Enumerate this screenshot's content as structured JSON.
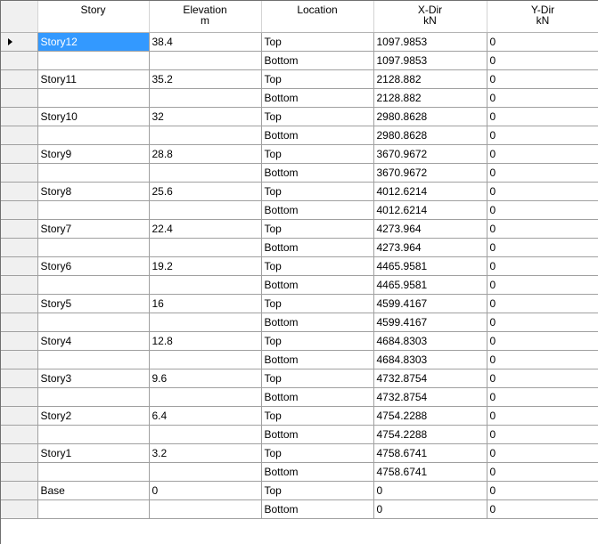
{
  "grid": {
    "columns": [
      {
        "title": "Story",
        "unit": ""
      },
      {
        "title": "Elevation",
        "unit": "m"
      },
      {
        "title": "Location",
        "unit": ""
      },
      {
        "title": "X-Dir",
        "unit": "kN"
      },
      {
        "title": "Y-Dir",
        "unit": "kN"
      }
    ],
    "current_row": 0,
    "selected_cell": {
      "row": 0,
      "col": 0
    },
    "rows": [
      {
        "story": "Story12",
        "elevation": "38.4",
        "location": "Top",
        "xdir": "1097.9853",
        "ydir": "0"
      },
      {
        "story": "",
        "elevation": "",
        "location": "Bottom",
        "xdir": "1097.9853",
        "ydir": "0"
      },
      {
        "story": "Story11",
        "elevation": "35.2",
        "location": "Top",
        "xdir": "2128.882",
        "ydir": "0"
      },
      {
        "story": "",
        "elevation": "",
        "location": "Bottom",
        "xdir": "2128.882",
        "ydir": "0"
      },
      {
        "story": "Story10",
        "elevation": "32",
        "location": "Top",
        "xdir": "2980.8628",
        "ydir": "0"
      },
      {
        "story": "",
        "elevation": "",
        "location": "Bottom",
        "xdir": "2980.8628",
        "ydir": "0"
      },
      {
        "story": "Story9",
        "elevation": "28.8",
        "location": "Top",
        "xdir": "3670.9672",
        "ydir": "0"
      },
      {
        "story": "",
        "elevation": "",
        "location": "Bottom",
        "xdir": "3670.9672",
        "ydir": "0"
      },
      {
        "story": "Story8",
        "elevation": "25.6",
        "location": "Top",
        "xdir": "4012.6214",
        "ydir": "0"
      },
      {
        "story": "",
        "elevation": "",
        "location": "Bottom",
        "xdir": "4012.6214",
        "ydir": "0"
      },
      {
        "story": "Story7",
        "elevation": "22.4",
        "location": "Top",
        "xdir": "4273.964",
        "ydir": "0"
      },
      {
        "story": "",
        "elevation": "",
        "location": "Bottom",
        "xdir": "4273.964",
        "ydir": "0"
      },
      {
        "story": "Story6",
        "elevation": "19.2",
        "location": "Top",
        "xdir": "4465.9581",
        "ydir": "0"
      },
      {
        "story": "",
        "elevation": "",
        "location": "Bottom",
        "xdir": "4465.9581",
        "ydir": "0"
      },
      {
        "story": "Story5",
        "elevation": "16",
        "location": "Top",
        "xdir": "4599.4167",
        "ydir": "0"
      },
      {
        "story": "",
        "elevation": "",
        "location": "Bottom",
        "xdir": "4599.4167",
        "ydir": "0"
      },
      {
        "story": "Story4",
        "elevation": "12.8",
        "location": "Top",
        "xdir": "4684.8303",
        "ydir": "0"
      },
      {
        "story": "",
        "elevation": "",
        "location": "Bottom",
        "xdir": "4684.8303",
        "ydir": "0"
      },
      {
        "story": "Story3",
        "elevation": "9.6",
        "location": "Top",
        "xdir": "4732.8754",
        "ydir": "0"
      },
      {
        "story": "",
        "elevation": "",
        "location": "Bottom",
        "xdir": "4732.8754",
        "ydir": "0"
      },
      {
        "story": "Story2",
        "elevation": "6.4",
        "location": "Top",
        "xdir": "4754.2288",
        "ydir": "0"
      },
      {
        "story": "",
        "elevation": "",
        "location": "Bottom",
        "xdir": "4754.2288",
        "ydir": "0"
      },
      {
        "story": "Story1",
        "elevation": "3.2",
        "location": "Top",
        "xdir": "4758.6741",
        "ydir": "0"
      },
      {
        "story": "",
        "elevation": "",
        "location": "Bottom",
        "xdir": "4758.6741",
        "ydir": "0"
      },
      {
        "story": "Base",
        "elevation": "0",
        "location": "Top",
        "xdir": "0",
        "ydir": "0"
      },
      {
        "story": "",
        "elevation": "",
        "location": "Bottom",
        "xdir": "0",
        "ydir": "0"
      }
    ]
  },
  "icons": {
    "current_row_indicator": "arrow-right-icon"
  },
  "colors": {
    "selection": "#3399ff",
    "row_header": "#f0f0f0",
    "grid_line": "#a0a0a0"
  }
}
